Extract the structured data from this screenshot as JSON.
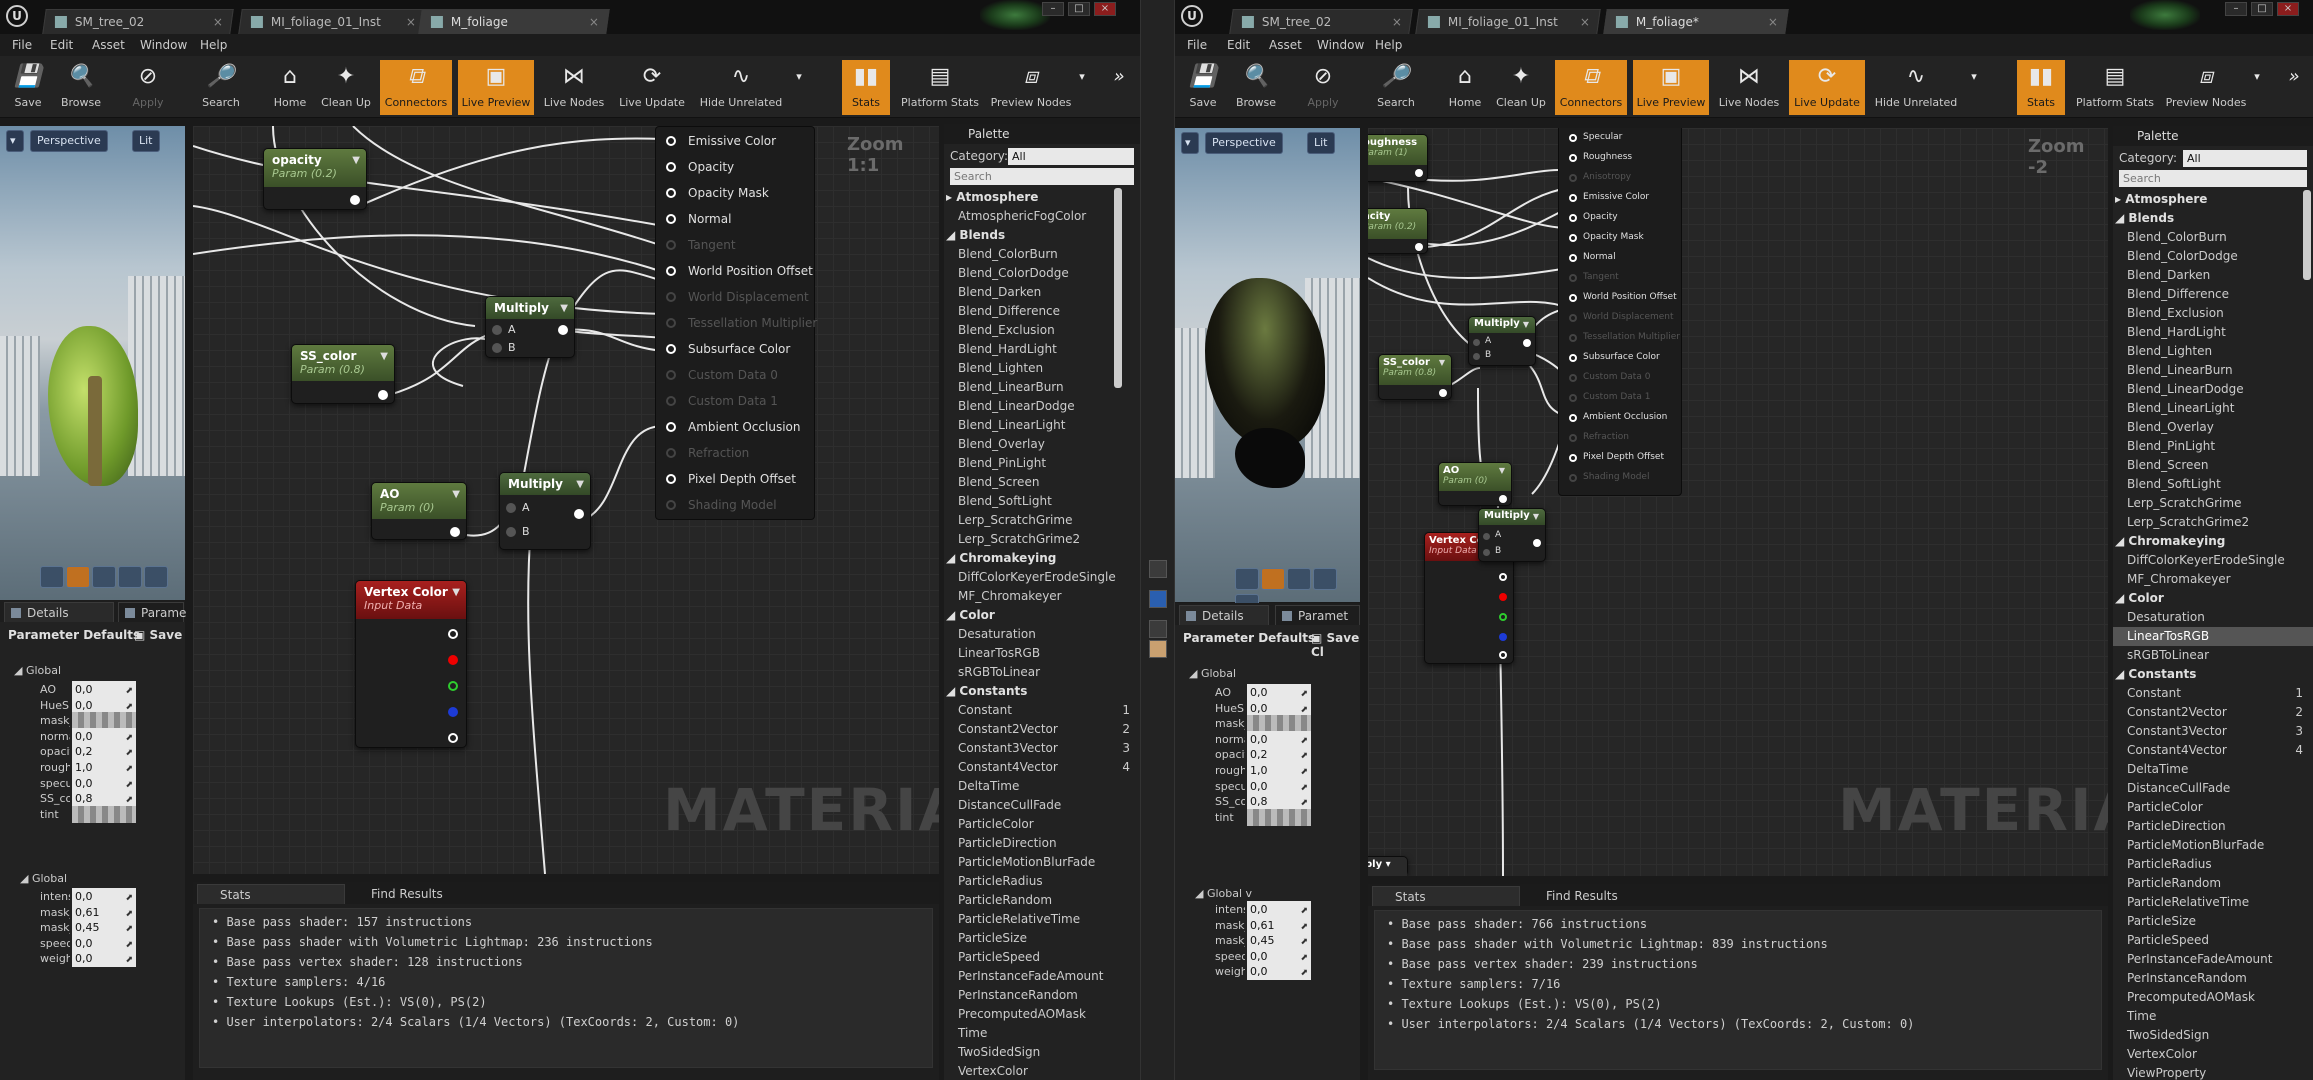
{
  "menu": [
    "File",
    "Edit",
    "Asset",
    "Window",
    "Help"
  ],
  "toolbar": {
    "save": "Save",
    "browse": "Browse",
    "apply": "Apply",
    "search": "Search",
    "home": "Home",
    "cleanup": "Clean Up",
    "connectors": "Connectors",
    "live_preview": "Live Preview",
    "live_nodes": "Live Nodes",
    "live_update": "Live Update",
    "hide_unrelated": "Hide Unrelated",
    "stats": "Stats",
    "platform_stats": "Platform Stats",
    "preview_nodes": "Preview Nodes"
  },
  "viewport": {
    "perspective": "Perspective",
    "lit": "Lit"
  },
  "panel_tabs": {
    "details": "Details",
    "params": "Paramet",
    "params_left": "Parame"
  },
  "details": {
    "header": "Parameter Defaults",
    "save_left": "Save",
    "save_right": "Save Cl",
    "global": "Global",
    "global2": "Global",
    "right_global2": "Global v",
    "left_params": [
      {
        "label": "AO",
        "value": "0,0"
      },
      {
        "label": "HueSh",
        "value": "0,0"
      },
      {
        "label": "mask_",
        "value": ""
      },
      {
        "label": "norma",
        "value": "0,0"
      },
      {
        "label": "opacit",
        "value": "0,2"
      },
      {
        "label": "rough",
        "value": "1,0"
      },
      {
        "label": "specu",
        "value": "0,0"
      },
      {
        "label": "SS_co",
        "value": "0,8"
      },
      {
        "label": "tint",
        "value": ""
      }
    ],
    "left_params2": [
      {
        "label": "intens",
        "value": "0,0"
      },
      {
        "label": "mask_",
        "value": "0,61"
      },
      {
        "label": "mask_",
        "value": "0,45"
      },
      {
        "label": "speed",
        "value": "0,0"
      },
      {
        "label": "weigh",
        "value": "0,0"
      }
    ],
    "right_params": [
      {
        "label": "AO",
        "value": "0,0"
      },
      {
        "label": "HueSh",
        "value": "0,0"
      },
      {
        "label": "mask_v",
        "value": ""
      },
      {
        "label": "normal",
        "value": "0,0"
      },
      {
        "label": "opacity",
        "value": "0,2"
      },
      {
        "label": "roughn",
        "value": "1,0"
      },
      {
        "label": "specula",
        "value": "0,0"
      },
      {
        "label": "SS_col",
        "value": "0,8"
      },
      {
        "label": "tint",
        "value": ""
      }
    ],
    "right_params2": [
      {
        "label": "intensi",
        "value": "0,0"
      },
      {
        "label": "mask_c",
        "value": "0,61"
      },
      {
        "label": "mask_i",
        "value": "0,45"
      },
      {
        "label": "speed",
        "value": "0,0"
      },
      {
        "label": "weight",
        "value": "0,0"
      }
    ]
  },
  "left": {
    "tabs": [
      "SM_tree_02",
      "MI_foliage_01_Inst",
      "M_foliage"
    ],
    "zoom": "Zoom 1:1",
    "watermark": "MATERIAL",
    "nodes": {
      "opacity": {
        "title": "opacity",
        "sub": "Param (0.2)"
      },
      "ss_color": {
        "title": "SS_color",
        "sub": "Param (0.8)"
      },
      "ao": {
        "title": "AO",
        "sub": "Param (0)"
      },
      "vertex": {
        "title": "Vertex Color",
        "sub": "Input Data"
      },
      "multiply1": {
        "title": "Multiply",
        "a": "A",
        "b": "B"
      },
      "multiply2": {
        "title": "Multiply",
        "a": "A",
        "b": "B"
      }
    },
    "result_pins": [
      {
        "label": "Emissive Color",
        "on": true
      },
      {
        "label": "Opacity",
        "on": true
      },
      {
        "label": "Opacity Mask",
        "on": true
      },
      {
        "label": "Normal",
        "on": true
      },
      {
        "label": "Tangent",
        "on": false
      },
      {
        "label": "World Position Offset",
        "on": true
      },
      {
        "label": "World Displacement",
        "on": false
      },
      {
        "label": "Tessellation Multiplier",
        "on": false
      },
      {
        "label": "Subsurface Color",
        "on": true
      },
      {
        "label": "Custom Data 0",
        "on": false
      },
      {
        "label": "Custom Data 1",
        "on": false
      },
      {
        "label": "Ambient Occlusion",
        "on": true
      },
      {
        "label": "Refraction",
        "on": false
      },
      {
        "label": "Pixel Depth Offset",
        "on": true
      },
      {
        "label": "Shading Model",
        "on": false
      }
    ],
    "stats": [
      "Base pass shader: 157 instructions",
      "Base pass shader with Volumetric Lightmap: 236 instructions",
      "Base pass vertex shader: 128 instructions",
      "Texture samplers: 4/16",
      "Texture Lookups (Est.): VS(0), PS(2)",
      "User interpolators: 2/4 Scalars (1/4 Vectors) (TexCoords: 2, Custom: 0)"
    ]
  },
  "right": {
    "tabs": [
      "SM_tree_02",
      "MI_foliage_01_Inst",
      "M_foliage*"
    ],
    "zoom": "Zoom -2",
    "watermark": "MATERIAL",
    "nodes": {
      "roughness": {
        "title": "oughness",
        "sub": "Param (1)"
      },
      "opacity": {
        "title": "acity",
        "sub": "Param (0.2)"
      },
      "ss_color": {
        "title": "SS_color",
        "sub": "Param (0.8)"
      },
      "ao": {
        "title": "AO",
        "sub": "Param (0)"
      },
      "vertex": {
        "title": "Vertex Color",
        "sub": "Input Data"
      },
      "multiply1": {
        "title": "Multiply",
        "a": "A",
        "b": "B"
      },
      "multiply2": {
        "title": "Multiply",
        "a": "A",
        "b": "B"
      },
      "apply": "ply"
    },
    "result_pins": [
      {
        "label": "Specular",
        "on": true
      },
      {
        "label": "Roughness",
        "on": true
      },
      {
        "label": "Anisotropy",
        "on": false
      },
      {
        "label": "Emissive Color",
        "on": true
      },
      {
        "label": "Opacity",
        "on": true
      },
      {
        "label": "Opacity Mask",
        "on": true
      },
      {
        "label": "Normal",
        "on": true
      },
      {
        "label": "Tangent",
        "on": false
      },
      {
        "label": "World Position Offset",
        "on": true
      },
      {
        "label": "World Displacement",
        "on": false
      },
      {
        "label": "Tessellation Multiplier",
        "on": false
      },
      {
        "label": "Subsurface Color",
        "on": true
      },
      {
        "label": "Custom Data 0",
        "on": false
      },
      {
        "label": "Custom Data 1",
        "on": false
      },
      {
        "label": "Ambient Occlusion",
        "on": true
      },
      {
        "label": "Refraction",
        "on": false
      },
      {
        "label": "Pixel Depth Offset",
        "on": true
      },
      {
        "label": "Shading Model",
        "on": false
      }
    ],
    "stats": [
      "Base pass shader: 766 instructions",
      "Base pass shader with Volumetric Lightmap: 839 instructions",
      "Base pass vertex shader: 239 instructions",
      "Texture samplers: 7/16",
      "Texture Lookups (Est.): VS(0), PS(2)",
      "User interpolators: 2/4 Scalars (1/4 Vectors) (TexCoords: 2, Custom: 0)"
    ]
  },
  "stats_tabs": {
    "stats": "Stats",
    "find": "Find Results"
  },
  "palette": {
    "title": "Palette",
    "category_label": "Category:",
    "category_value": "All",
    "search_placeholder": "Search",
    "left_items": [
      {
        "t": "Atmosphere",
        "h": true
      },
      {
        "t": "AtmosphericFogColor"
      },
      {
        "t": "Blends",
        "h": true
      },
      {
        "t": "Blend_ColorBurn"
      },
      {
        "t": "Blend_ColorDodge"
      },
      {
        "t": "Blend_Darken"
      },
      {
        "t": "Blend_Difference"
      },
      {
        "t": "Blend_Exclusion"
      },
      {
        "t": "Blend_HardLight"
      },
      {
        "t": "Blend_Lighten"
      },
      {
        "t": "Blend_LinearBurn"
      },
      {
        "t": "Blend_LinearDodge"
      },
      {
        "t": "Blend_LinearLight"
      },
      {
        "t": "Blend_Overlay"
      },
      {
        "t": "Blend_PinLight"
      },
      {
        "t": "Blend_Screen"
      },
      {
        "t": "Blend_SoftLight"
      },
      {
        "t": "Lerp_ScratchGrime"
      },
      {
        "t": "Lerp_ScratchGrime2"
      },
      {
        "t": "Chromakeying",
        "h": true
      },
      {
        "t": "DiffColorKeyerErodeSingle"
      },
      {
        "t": "MF_Chromakeyer"
      },
      {
        "t": "Color",
        "h": true
      },
      {
        "t": "Desaturation"
      },
      {
        "t": "LinearTosRGB"
      },
      {
        "t": "sRGBToLinear"
      },
      {
        "t": "Constants",
        "h": true
      },
      {
        "t": "Constant",
        "k": "1"
      },
      {
        "t": "Constant2Vector",
        "k": "2"
      },
      {
        "t": "Constant3Vector",
        "k": "3"
      },
      {
        "t": "Constant4Vector",
        "k": "4"
      },
      {
        "t": "DeltaTime"
      },
      {
        "t": "DistanceCullFade"
      },
      {
        "t": "ParticleColor"
      },
      {
        "t": "ParticleDirection"
      },
      {
        "t": "ParticleMotionBlurFade"
      },
      {
        "t": "ParticleRadius"
      },
      {
        "t": "ParticleRandom"
      },
      {
        "t": "ParticleRelativeTime"
      },
      {
        "t": "ParticleSize"
      },
      {
        "t": "ParticleSpeed"
      },
      {
        "t": "PerInstanceFadeAmount"
      },
      {
        "t": "PerInstanceRandom"
      },
      {
        "t": "PrecomputedAOMask"
      },
      {
        "t": "Time"
      },
      {
        "t": "TwoSidedSign"
      },
      {
        "t": "VertexColor"
      }
    ],
    "right_items": [
      {
        "t": "Atmosphere",
        "h": true
      },
      {
        "t": "Blends",
        "h": true
      },
      {
        "t": "Blend_ColorBurn"
      },
      {
        "t": "Blend_ColorDodge"
      },
      {
        "t": "Blend_Darken"
      },
      {
        "t": "Blend_Difference"
      },
      {
        "t": "Blend_Exclusion"
      },
      {
        "t": "Blend_HardLight"
      },
      {
        "t": "Blend_Lighten"
      },
      {
        "t": "Blend_LinearBurn"
      },
      {
        "t": "Blend_LinearDodge"
      },
      {
        "t": "Blend_LinearLight"
      },
      {
        "t": "Blend_Overlay"
      },
      {
        "t": "Blend_PinLight"
      },
      {
        "t": "Blend_Screen"
      },
      {
        "t": "Blend_SoftLight"
      },
      {
        "t": "Lerp_ScratchGrime"
      },
      {
        "t": "Lerp_ScratchGrime2"
      },
      {
        "t": "Chromakeying",
        "h": true
      },
      {
        "t": "DiffColorKeyerErodeSingle"
      },
      {
        "t": "MF_Chromakeyer"
      },
      {
        "t": "Color",
        "h": true,
        "sel": true
      },
      {
        "t": "Desaturation"
      },
      {
        "t": "LinearTosRGB",
        "sel": true
      },
      {
        "t": "sRGBToLinear"
      },
      {
        "t": "Constants",
        "h": true
      },
      {
        "t": "Constant",
        "k": "1"
      },
      {
        "t": "Constant2Vector",
        "k": "2"
      },
      {
        "t": "Constant3Vector",
        "k": "3"
      },
      {
        "t": "Constant4Vector",
        "k": "4"
      },
      {
        "t": "DeltaTime"
      },
      {
        "t": "DistanceCullFade"
      },
      {
        "t": "ParticleColor"
      },
      {
        "t": "ParticleDirection"
      },
      {
        "t": "ParticleMotionBlurFade"
      },
      {
        "t": "ParticleRadius"
      },
      {
        "t": "ParticleRandom"
      },
      {
        "t": "ParticleRelativeTime"
      },
      {
        "t": "ParticleSize"
      },
      {
        "t": "ParticleSpeed"
      },
      {
        "t": "PerInstanceFadeAmount"
      },
      {
        "t": "PerInstanceRandom"
      },
      {
        "t": "PrecomputedAOMask"
      },
      {
        "t": "Time"
      },
      {
        "t": "TwoSidedSign"
      },
      {
        "t": "VertexColor"
      },
      {
        "t": "ViewProperty"
      }
    ]
  },
  "colors": {
    "accent": "#e08a1c",
    "param_node": "#4e6a3e",
    "input_node": "#a8201e",
    "bg": "#262626"
  }
}
